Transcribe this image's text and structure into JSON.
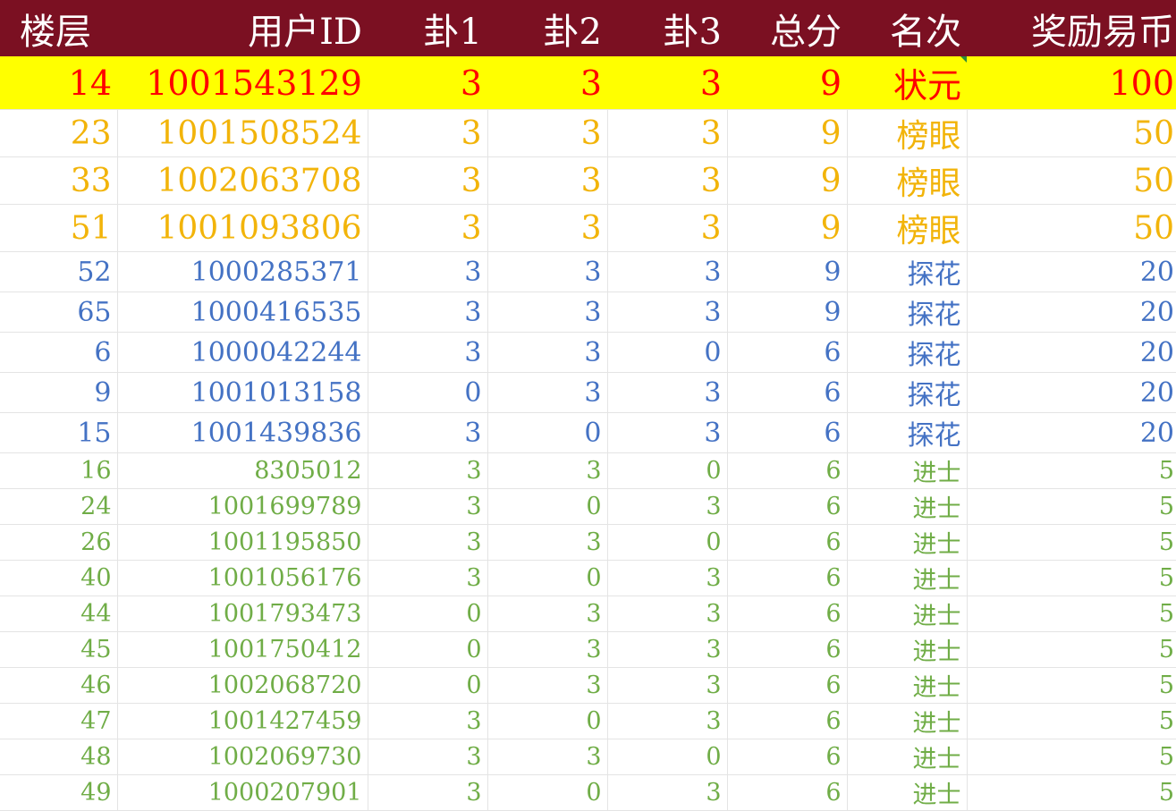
{
  "header": {
    "floor": "楼层",
    "user_id": "用户ID",
    "gua1": "卦1",
    "gua2": "卦2",
    "gua3": "卦3",
    "total": "总分",
    "rank": "名次",
    "reward": "奖励易币"
  },
  "colors": {
    "header_bg": "#7b1022",
    "tier1_bg": "#ffff00",
    "tier1_text": "#ff0000",
    "tier2_text": "#f2b40a",
    "tier3_text": "#4472c4",
    "tier4_text": "#70ad47"
  },
  "rows": [
    {
      "floor": "14",
      "user_id": "1001543129",
      "g1": "3",
      "g2": "3",
      "g3": "3",
      "total": "9",
      "rank": "状元",
      "reward": "100",
      "tier": "tier1"
    },
    {
      "floor": "23",
      "user_id": "1001508524",
      "g1": "3",
      "g2": "3",
      "g3": "3",
      "total": "9",
      "rank": "榜眼",
      "reward": "50",
      "tier": "tier2"
    },
    {
      "floor": "33",
      "user_id": "1002063708",
      "g1": "3",
      "g2": "3",
      "g3": "3",
      "total": "9",
      "rank": "榜眼",
      "reward": "50",
      "tier": "tier2"
    },
    {
      "floor": "51",
      "user_id": "1001093806",
      "g1": "3",
      "g2": "3",
      "g3": "3",
      "total": "9",
      "rank": "榜眼",
      "reward": "50",
      "tier": "tier2"
    },
    {
      "floor": "52",
      "user_id": "1000285371",
      "g1": "3",
      "g2": "3",
      "g3": "3",
      "total": "9",
      "rank": "探花",
      "reward": "20",
      "tier": "tier3"
    },
    {
      "floor": "65",
      "user_id": "1000416535",
      "g1": "3",
      "g2": "3",
      "g3": "3",
      "total": "9",
      "rank": "探花",
      "reward": "20",
      "tier": "tier3"
    },
    {
      "floor": "6",
      "user_id": "1000042244",
      "g1": "3",
      "g2": "3",
      "g3": "0",
      "total": "6",
      "rank": "探花",
      "reward": "20",
      "tier": "tier3"
    },
    {
      "floor": "9",
      "user_id": "1001013158",
      "g1": "0",
      "g2": "3",
      "g3": "3",
      "total": "6",
      "rank": "探花",
      "reward": "20",
      "tier": "tier3"
    },
    {
      "floor": "15",
      "user_id": "1001439836",
      "g1": "3",
      "g2": "0",
      "g3": "3",
      "total": "6",
      "rank": "探花",
      "reward": "20",
      "tier": "tier3"
    },
    {
      "floor": "16",
      "user_id": "8305012",
      "g1": "3",
      "g2": "3",
      "g3": "0",
      "total": "6",
      "rank": "进士",
      "reward": "5",
      "tier": "tier4"
    },
    {
      "floor": "24",
      "user_id": "1001699789",
      "g1": "3",
      "g2": "0",
      "g3": "3",
      "total": "6",
      "rank": "进士",
      "reward": "5",
      "tier": "tier4"
    },
    {
      "floor": "26",
      "user_id": "1001195850",
      "g1": "3",
      "g2": "3",
      "g3": "0",
      "total": "6",
      "rank": "进士",
      "reward": "5",
      "tier": "tier4"
    },
    {
      "floor": "40",
      "user_id": "1001056176",
      "g1": "3",
      "g2": "0",
      "g3": "3",
      "total": "6",
      "rank": "进士",
      "reward": "5",
      "tier": "tier4"
    },
    {
      "floor": "44",
      "user_id": "1001793473",
      "g1": "0",
      "g2": "3",
      "g3": "3",
      "total": "6",
      "rank": "进士",
      "reward": "5",
      "tier": "tier4"
    },
    {
      "floor": "45",
      "user_id": "1001750412",
      "g1": "0",
      "g2": "3",
      "g3": "3",
      "total": "6",
      "rank": "进士",
      "reward": "5",
      "tier": "tier4"
    },
    {
      "floor": "46",
      "user_id": "1002068720",
      "g1": "0",
      "g2": "3",
      "g3": "3",
      "total": "6",
      "rank": "进士",
      "reward": "5",
      "tier": "tier4"
    },
    {
      "floor": "47",
      "user_id": "1001427459",
      "g1": "3",
      "g2": "0",
      "g3": "3",
      "total": "6",
      "rank": "进士",
      "reward": "5",
      "tier": "tier4"
    },
    {
      "floor": "48",
      "user_id": "1002069730",
      "g1": "3",
      "g2": "3",
      "g3": "0",
      "total": "6",
      "rank": "进士",
      "reward": "5",
      "tier": "tier4"
    },
    {
      "floor": "49",
      "user_id": "1000207901",
      "g1": "3",
      "g2": "0",
      "g3": "3",
      "total": "6",
      "rank": "进士",
      "reward": "5",
      "tier": "tier4"
    }
  ]
}
